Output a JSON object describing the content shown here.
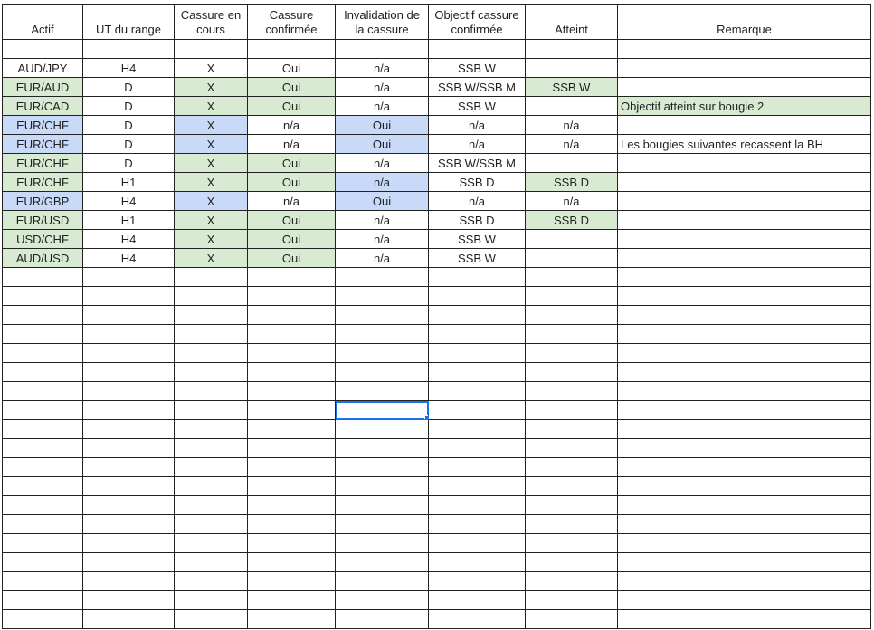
{
  "headers": [
    "Actif",
    "UT du range",
    "Cassure en cours",
    "Cassure confirmée",
    "Invalidation de la cassure",
    "Objectif cassure confirmée",
    "Atteint",
    "Remarque"
  ],
  "rows": [
    {
      "cells": [
        "AUD/JPY",
        "H4",
        "X",
        "Oui",
        "n/a",
        "SSB W",
        "",
        ""
      ],
      "fill": [
        "",
        "",
        "",
        "",
        "",
        "",
        "",
        ""
      ]
    },
    {
      "cells": [
        "EUR/AUD",
        "D",
        "X",
        "Oui",
        "n/a",
        "SSB W/SSB M",
        "SSB W",
        ""
      ],
      "fill": [
        "g",
        "",
        "g",
        "g",
        "",
        "",
        "g",
        ""
      ]
    },
    {
      "cells": [
        "EUR/CAD",
        "D",
        "X",
        "Oui",
        "n/a",
        "SSB W",
        "",
        "Objectif atteint sur bougie 2"
      ],
      "fill": [
        "g",
        "",
        "g",
        "g",
        "",
        "",
        "",
        "g"
      ]
    },
    {
      "cells": [
        "EUR/CHF",
        "D",
        "X",
        "n/a",
        "Oui",
        "n/a",
        "n/a",
        ""
      ],
      "fill": [
        "b",
        "",
        "b",
        "",
        "b",
        "",
        "",
        ""
      ]
    },
    {
      "cells": [
        "EUR/CHF",
        "D",
        "X",
        "n/a",
        "Oui",
        "n/a",
        "n/a",
        "Les bougies suivantes recassent la BH"
      ],
      "fill": [
        "b",
        "",
        "b",
        "",
        "b",
        "",
        "",
        ""
      ]
    },
    {
      "cells": [
        "EUR/CHF",
        "D",
        "X",
        "Oui",
        "n/a",
        "SSB W/SSB M",
        "",
        ""
      ],
      "fill": [
        "g",
        "",
        "g",
        "g",
        "",
        "",
        "",
        ""
      ]
    },
    {
      "cells": [
        "EUR/CHF",
        "H1",
        "X",
        "Oui",
        "n/a",
        "SSB D",
        "SSB D",
        ""
      ],
      "fill": [
        "g",
        "",
        "g",
        "g",
        "b",
        "",
        "g",
        ""
      ]
    },
    {
      "cells": [
        "EUR/GBP",
        "H4",
        "X",
        "n/a",
        "Oui",
        "n/a",
        "n/a",
        ""
      ],
      "fill": [
        "b",
        "",
        "b",
        "",
        "b",
        "",
        "",
        ""
      ]
    },
    {
      "cells": [
        "EUR/USD",
        "H1",
        "X",
        "Oui",
        "n/a",
        "SSB D",
        "SSB D",
        ""
      ],
      "fill": [
        "g",
        "",
        "g",
        "g",
        "",
        "",
        "g",
        ""
      ]
    },
    {
      "cells": [
        "USD/CHF",
        "H4",
        "X",
        "Oui",
        "n/a",
        "SSB W",
        "",
        ""
      ],
      "fill": [
        "g",
        "",
        "g",
        "g",
        "",
        "",
        "",
        ""
      ]
    },
    {
      "cells": [
        "AUD/USD",
        "H4",
        "X",
        "Oui",
        "n/a",
        "SSB W",
        "",
        ""
      ],
      "fill": [
        "g",
        "",
        "g",
        "g",
        "",
        "",
        "",
        ""
      ]
    }
  ],
  "colors": {
    "green_fill": "#d9ead3",
    "blue_fill": "#c9daf8",
    "selection": "#1a73e8"
  }
}
